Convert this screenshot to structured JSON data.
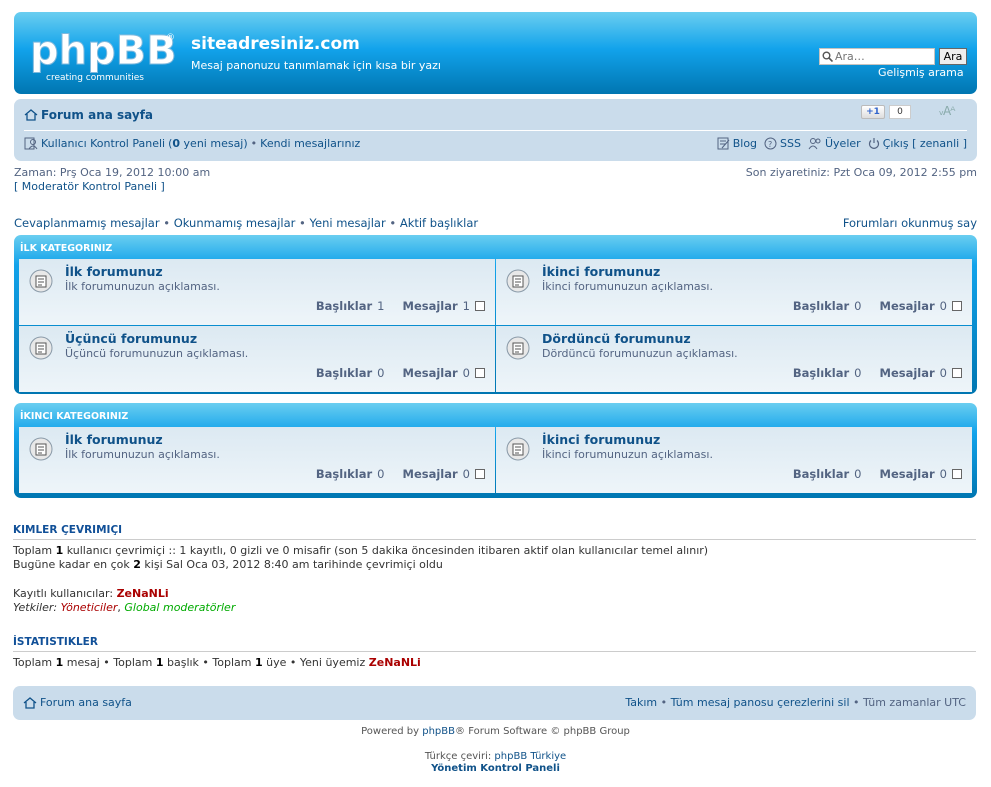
{
  "header": {
    "logo_text": "phpBB",
    "logo_tagline": "creating communities",
    "site_title": "siteadresiniz.com",
    "site_desc": "Mesaj panonuzu tanımlamak için kısa bir yazı",
    "search_placeholder": "Ara…",
    "search_button": "Ara",
    "advanced_search": "Gelişmiş arama"
  },
  "navbar": {
    "home": "Forum ana sayfa",
    "plusone": "+1",
    "plusone_count": "0",
    "font_resize": "ᵥAᴬ",
    "ucp": "Kullanıcı Kontrol Paneli",
    "new_messages_open": "(",
    "new_messages_count": "0",
    "new_messages_text": "yeni mesaj)",
    "sep": "•",
    "own_posts": "Kendi mesajlarınız",
    "blog": "Blog",
    "faq": "SSS",
    "members": "Üyeler",
    "logout": "Çıkış [ zenanli ]"
  },
  "info": {
    "time": "Zaman: Prş Oca 19, 2012 10:00 am",
    "mcp": "[ Moderatör Kontrol Paneli ]",
    "last_visit": "Son ziyaretiniz: Pzt Oca 09, 2012 2:55 pm",
    "quick_links": [
      "Cevaplanmamış mesajlar",
      "Okunmamış mesajlar",
      "Yeni mesajlar",
      "Aktif başlıklar"
    ],
    "mark_read": "Forumları okunmuş say"
  },
  "stats_labels": {
    "topics": "Başlıklar",
    "posts": "Mesajlar"
  },
  "categories": [
    {
      "title": "İLK KATEGORINIZ",
      "forums": [
        {
          "name": "İlk forumunuz",
          "desc": "İlk forumunuzun açıklaması.",
          "topics": "1",
          "posts": "1"
        },
        {
          "name": "İkinci forumunuz",
          "desc": "İkinci forumunuzun açıklaması.",
          "topics": "0",
          "posts": "0"
        },
        {
          "name": "Üçüncü forumunuz",
          "desc": "Üçüncü forumunuzun açıklaması.",
          "topics": "0",
          "posts": "0"
        },
        {
          "name": "Dördüncü forumunuz",
          "desc": "Dördüncü forumunuzun açıklaması.",
          "topics": "0",
          "posts": "0"
        }
      ]
    },
    {
      "title": "İKINCI KATEGORINIZ",
      "forums": [
        {
          "name": "İlk forumunuz",
          "desc": "İlk forumunuzun açıklaması.",
          "topics": "0",
          "posts": "0"
        },
        {
          "name": "İkinci forumunuz",
          "desc": "İkinci forumunuzun açıklaması.",
          "topics": "0",
          "posts": "0"
        }
      ]
    }
  ],
  "online": {
    "title": "KIMLER ÇEVRIMIÇI",
    "line1_a": "Toplam",
    "line1_n": "1",
    "line1_b": "kullanıcı çevrimiçi :: 1 kayıtlı, 0 gizli ve 0 misafir (son 5 dakika öncesinden itibaren aktif olan kullanıcılar temel alınır)",
    "line2_a": "Bugüne kadar en çok",
    "line2_n": "2",
    "line2_b": "kişi Sal Oca 03, 2012 8:40 am tarihinde çevrimiçi oldu",
    "registered_label": "Kayıtlı kullanıcılar:",
    "registered_user": "ZeNaNLi",
    "legend_label": "Yetkiler:",
    "legend_admin": "Yöneticiler",
    "legend_sep": ",",
    "legend_gmod": "Global moderatörler"
  },
  "statistics": {
    "title": "İSTATISTIKLER",
    "total": "Toplam",
    "posts_n": "1",
    "posts": "mesaj",
    "topics_n": "1",
    "topics": "başlık",
    "users_n": "1",
    "users": "üye",
    "newest": "Yeni üyemiz",
    "newest_user": "ZeNaNLi",
    "sep": "•"
  },
  "footer": {
    "home": "Forum ana sayfa",
    "team": "Takım",
    "cookies": "Tüm mesaj panosu çerezlerini sil",
    "timezone": "Tüm zamanlar UTC",
    "sep": "•",
    "powered_a": "Powered by",
    "powered_link": "phpBB",
    "powered_b": "® Forum Software © phpBB Group",
    "translation_a": "Türkçe çeviri:",
    "translation_link": "phpBB Türkiye",
    "acp": "Yönetim Kontrol Paneli"
  },
  "colors": {
    "accent": "#12a3eb",
    "navbar": "#cadceb",
    "link": "#105289",
    "admin": "#aa0000",
    "gmod": "#00aa00"
  }
}
